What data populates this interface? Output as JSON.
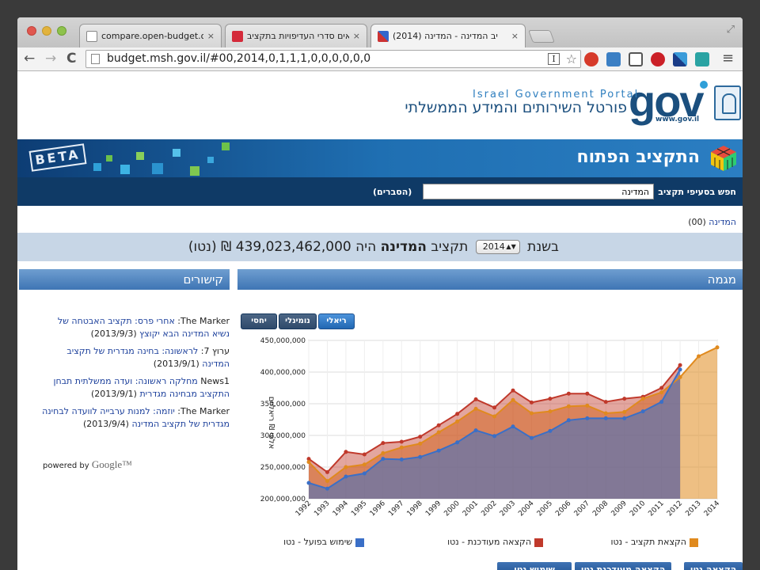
{
  "browser": {
    "tabs": [
      {
        "title": "compare.open-budget.org",
        "close": "×"
      },
      {
        "title": "אים סדרי העדיפויות בתקציב?",
        "close": "×"
      },
      {
        "title": "יב המדינה - המדינה (2014)",
        "close": "×"
      }
    ],
    "url": "budget.msh.gov.il/#00,2014,0,1,1,1,0,0,0,0,0,0",
    "reader_glyph": "I",
    "back": "←",
    "forward": "→",
    "reload": "C",
    "menu": "≡",
    "star": "☆",
    "resize": "⤢"
  },
  "header": {
    "portal_en": "Israel Government Portal",
    "portal_he": "פורטל השירותים והמידע הממשלתי",
    "logo_text": "gov",
    "logo_site": "www.gov.il"
  },
  "banner": {
    "beta": "BETA",
    "title": "התקציב הפתוח"
  },
  "search": {
    "label": "חפש בסעיפי תקציב",
    "value": "המדינה",
    "explain": "(הסברים)"
  },
  "breadcrumb": {
    "label": "המדינה",
    "code": "(00)"
  },
  "summary": {
    "prefix": "בשנת",
    "year": "2014",
    "mid": "תקציב",
    "entity": "המדינה",
    "is": "היה",
    "amount": "439,023,462,000 ₪ (נטו)"
  },
  "links_panel": {
    "title": "קישורים",
    "items": [
      {
        "source": "The Marker:",
        "text": "אחרי פרס: תקציב האבטחה של נשיא המדינה הבא יקוצץ",
        "date": "(2013/9/3)"
      },
      {
        "source": "ערוץ 7:",
        "text": "לראשונה: בחינה מגדרית של תקציב המדינה",
        "date": "(2013/9/1)"
      },
      {
        "source": "News1",
        "text": "מחלקה ראשונה: ועדה ממשלתית תבחן התקציב מבחינה מגדרית",
        "date": "(2013/9/1)"
      },
      {
        "source": "The Marker:",
        "text": "יוזמה: למנות ערבייה לוועדה לבחינה מגדרית של תקציב המדינה",
        "date": "(2013/9/4)"
      }
    ],
    "powered_by": "powered by",
    "google": "Google™"
  },
  "trend_panel": {
    "title": "מגמה",
    "modes": [
      "ריאלי",
      "נומינלי",
      "יחסי"
    ],
    "active_mode": "ריאלי",
    "legend": [
      {
        "label": "הקצאת תקציב - נטו",
        "color": "#e08a1e"
      },
      {
        "label": "הקצאה מעודכנת - נטו",
        "color": "#c0392b"
      },
      {
        "label": "שימוש בפועל - נטו",
        "color": "#3a6fc7"
      }
    ],
    "bottom_tabs": [
      "הקצאה נטו",
      "הקצאה מעודכנת נטו",
      "שימוש נטו"
    ]
  },
  "chart_data": {
    "type": "area",
    "ylabel": "אלפי ₪ ריאליים",
    "ylim": [
      200000000,
      450000000
    ],
    "yticks": [
      "200,000,000",
      "250,000,000",
      "300,000,000",
      "350,000,000",
      "400,000,000",
      "450,000,000"
    ],
    "x": [
      "1992",
      "1993",
      "1994",
      "1995",
      "1996",
      "1997",
      "1998",
      "1999",
      "2000",
      "2001",
      "2002",
      "2003",
      "2004",
      "2005",
      "2006",
      "2007",
      "2008",
      "2009",
      "2010",
      "2011",
      "2012",
      "2013",
      "2014"
    ],
    "series": [
      {
        "name": "הקצאה מעודכנת - נטו",
        "color": "#c0392b",
        "values": [
          263000000,
          242000000,
          274000000,
          270000000,
          288000000,
          290000000,
          298000000,
          316000000,
          334000000,
          357000000,
          344000000,
          371000000,
          352000000,
          358000000,
          366000000,
          366000000,
          353000000,
          358000000,
          361000000,
          375000000,
          411000000,
          null,
          null
        ]
      },
      {
        "name": "הקצאת תקציב - נטו",
        "color": "#e08a1e",
        "values": [
          258000000,
          228000000,
          250000000,
          254000000,
          272000000,
          281000000,
          287000000,
          305000000,
          322000000,
          342000000,
          330000000,
          356000000,
          335000000,
          338000000,
          346000000,
          347000000,
          335000000,
          337000000,
          358000000,
          368000000,
          392000000,
          425000000,
          439000000
        ]
      },
      {
        "name": "שימוש בפועל - נטו",
        "color": "#3a6fc7",
        "values": [
          225000000,
          216000000,
          235000000,
          240000000,
          263000000,
          262000000,
          266000000,
          276000000,
          289000000,
          308000000,
          299000000,
          314000000,
          296000000,
          307000000,
          324000000,
          327000000,
          327000000,
          327000000,
          338000000,
          353000000,
          404000000,
          null,
          null
        ]
      }
    ]
  }
}
